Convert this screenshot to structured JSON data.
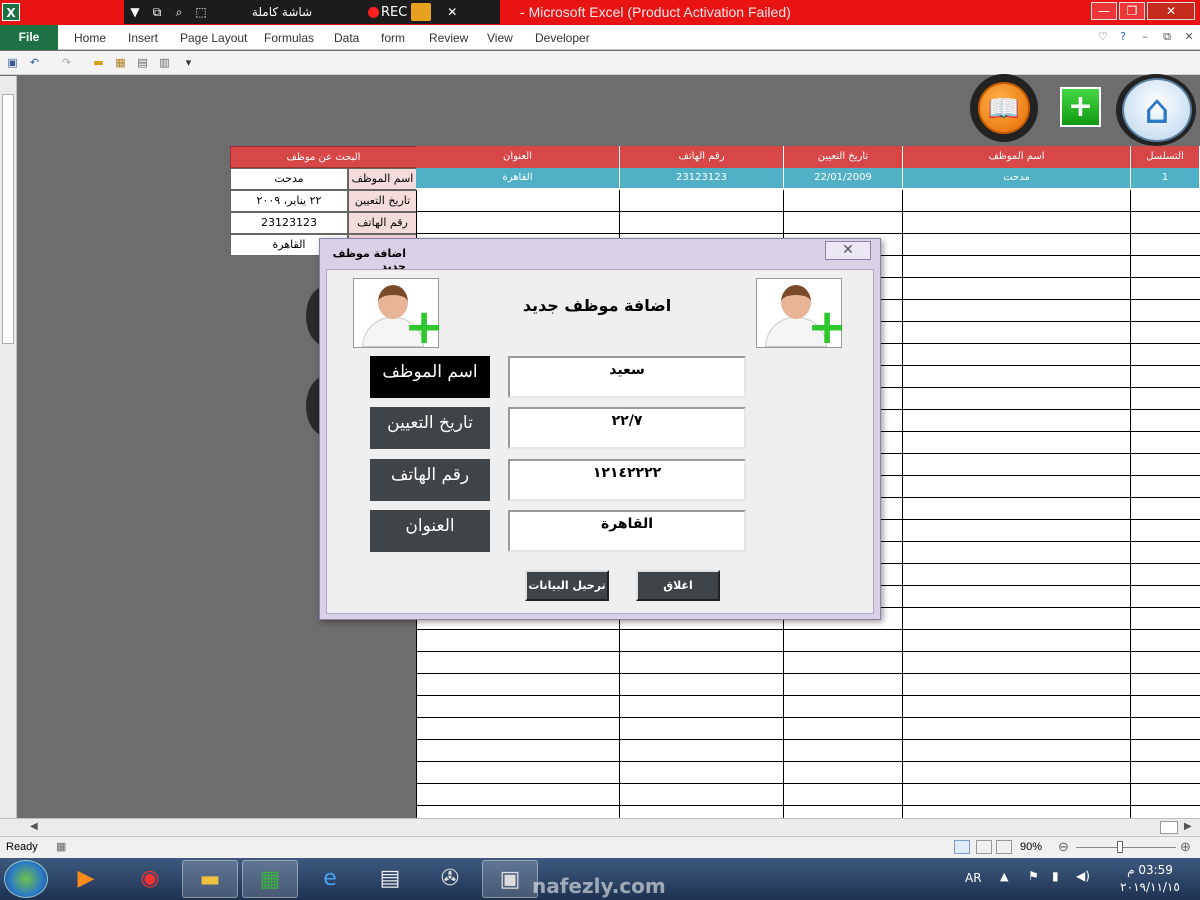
{
  "window": {
    "title": "Microsoft Excel (Product Activation Failed)",
    "title_prefix": "- "
  },
  "recorder": {
    "title": "شاشة كاملة",
    "rec_label": "REC"
  },
  "ribbon": {
    "tabs": [
      "File",
      "Home",
      "Insert",
      "Page Layout",
      "Formulas",
      "Data",
      "form",
      "Review",
      "View",
      "Developer"
    ]
  },
  "search_panel": {
    "header": "البحث عن موظف",
    "rows": [
      {
        "label": "اسم الموظف",
        "value": "مدحت"
      },
      {
        "label": "تاريخ التعيين",
        "value": "٢٢ يناير، ٢٠٠٩"
      },
      {
        "label": "رقم الهاتف",
        "value": "23123123"
      },
      {
        "label": "",
        "value": "القاهرة"
      }
    ]
  },
  "table": {
    "columns": [
      "العنوان",
      "رقم الهاتف",
      "تاريخ التعيين",
      "اسم الموظف",
      "التسلسل"
    ],
    "rows": [
      {
        "address": "القاهرة",
        "phone": "23123123",
        "hire_date": "22/01/2009",
        "name": "مدحت",
        "seq": "1"
      }
    ]
  },
  "dialog": {
    "title": "اضافة موظف جديد",
    "heading": "اضافة موظف جديد",
    "fields": [
      {
        "label": "اسم الموظف",
        "value": "سعيد"
      },
      {
        "label": "تاريخ التعيين",
        "value": "٢٢/٧"
      },
      {
        "label": "رقم الهاتف",
        "value": "١٢١٤٢٢٢٢"
      },
      {
        "label": "العنوان",
        "value": "القاهرة"
      }
    ],
    "submit_label": "ترحيل البيانات",
    "close_label": "اغلاق"
  },
  "status": {
    "ready": "Ready",
    "zoom": "90%"
  },
  "taskbar": {
    "lang": "AR",
    "time": "03:59 م",
    "date": "٢٠١٩/١١/١٥"
  },
  "watermark": "nafezly.com",
  "colors": {
    "title_bar": "#e81414",
    "excel_green": "#1e7145",
    "table_header": "#d74747",
    "selected_row": "#4fb0c6",
    "dialog_label_black": "#000000",
    "dialog_label_gray": "#3f4448"
  }
}
